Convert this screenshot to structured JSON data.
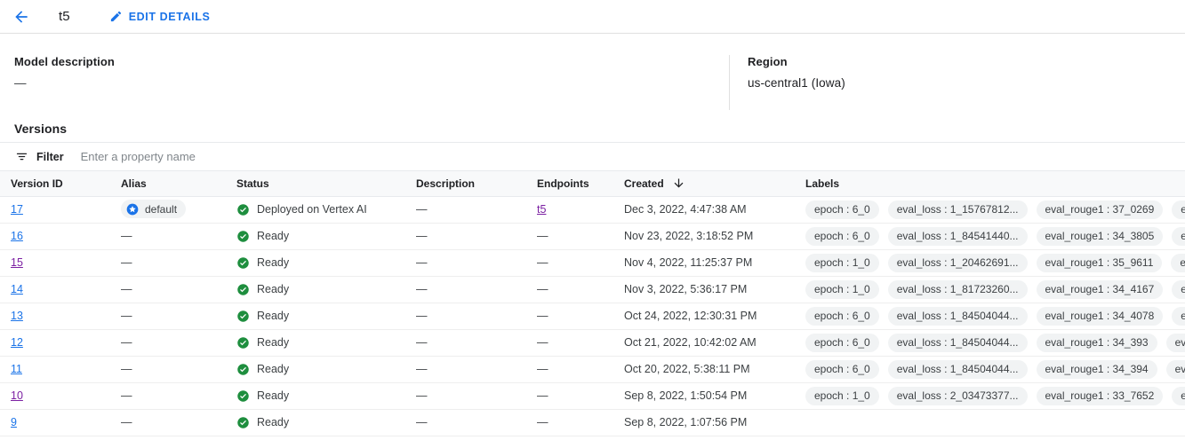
{
  "topbar": {
    "back_icon": "arrow-back-icon",
    "title": "t5",
    "edit_label": "EDIT DETAILS",
    "edit_icon": "pencil-icon",
    "accent": "#1a73e8"
  },
  "summary": {
    "description_label": "Model description",
    "description_value": "—",
    "region_label": "Region",
    "region_value": "us-central1 (Iowa)"
  },
  "versions_section": {
    "title": "Versions",
    "filter": {
      "icon": "filter-icon",
      "label": "Filter",
      "placeholder": "Enter a property name",
      "value": ""
    },
    "columns": [
      {
        "label": "Version ID",
        "muted": false
      },
      {
        "label": "Alias",
        "muted": false
      },
      {
        "label": "Status",
        "muted": false
      },
      {
        "label": "Description",
        "muted": false
      },
      {
        "label": "Endpoints",
        "muted": true
      },
      {
        "label": "Created",
        "muted": false
      },
      {
        "label": "Labels",
        "muted": true
      }
    ],
    "sort": {
      "column": "Created",
      "direction": "desc",
      "icon": "arrow-down-icon"
    },
    "rows": [
      {
        "version_id": "17",
        "visited": false,
        "alias": "default",
        "alias_is_chip": true,
        "alias_icon": "star-circle-icon",
        "status": "Deployed on Vertex AI",
        "status_icon": "check-circle-icon",
        "description": "—",
        "endpoint": "t5",
        "endpoint_is_link": true,
        "endpoint_visited": true,
        "created": "Dec 3, 2022, 4:47:38 AM",
        "labels": [
          "epoch : 6_0",
          "eval_loss : 1_15767812...",
          "eval_rouge1 : 37_0269",
          "eval"
        ]
      },
      {
        "version_id": "16",
        "visited": false,
        "alias": "—",
        "alias_is_chip": false,
        "status": "Ready",
        "status_icon": "check-circle-icon",
        "description": "—",
        "endpoint": "—",
        "endpoint_is_link": false,
        "created": "Nov 23, 2022, 3:18:52 PM",
        "labels": [
          "epoch : 6_0",
          "eval_loss : 1_84541440...",
          "eval_rouge1 : 34_3805",
          "eval"
        ]
      },
      {
        "version_id": "15",
        "visited": true,
        "alias": "—",
        "alias_is_chip": false,
        "status": "Ready",
        "status_icon": "check-circle-icon",
        "description": "—",
        "endpoint": "—",
        "endpoint_is_link": false,
        "created": "Nov 4, 2022, 11:25:37 PM",
        "labels": [
          "epoch : 1_0",
          "eval_loss : 1_20462691...",
          "eval_rouge1 : 35_9611",
          "eval"
        ]
      },
      {
        "version_id": "14",
        "visited": false,
        "alias": "—",
        "alias_is_chip": false,
        "status": "Ready",
        "status_icon": "check-circle-icon",
        "description": "—",
        "endpoint": "—",
        "endpoint_is_link": false,
        "created": "Nov 3, 2022, 5:36:17 PM",
        "labels": [
          "epoch : 1_0",
          "eval_loss : 1_81723260...",
          "eval_rouge1 : 34_4167",
          "eval"
        ]
      },
      {
        "version_id": "13",
        "visited": false,
        "alias": "—",
        "alias_is_chip": false,
        "status": "Ready",
        "status_icon": "check-circle-icon",
        "description": "—",
        "endpoint": "—",
        "endpoint_is_link": false,
        "created": "Oct 24, 2022, 12:30:31 PM",
        "labels": [
          "epoch : 6_0",
          "eval_loss : 1_84504044...",
          "eval_rouge1 : 34_4078",
          "eval"
        ]
      },
      {
        "version_id": "12",
        "visited": false,
        "alias": "—",
        "alias_is_chip": false,
        "status": "Ready",
        "status_icon": "check-circle-icon",
        "description": "—",
        "endpoint": "—",
        "endpoint_is_link": false,
        "created": "Oct 21, 2022, 10:42:02 AM",
        "labels": [
          "epoch : 6_0",
          "eval_loss : 1_84504044...",
          "eval_rouge1 : 34_393",
          "eval_"
        ]
      },
      {
        "version_id": "11",
        "visited": false,
        "alias": "—",
        "alias_is_chip": false,
        "status": "Ready",
        "status_icon": "check-circle-icon",
        "description": "—",
        "endpoint": "—",
        "endpoint_is_link": false,
        "created": "Oct 20, 2022, 5:38:11 PM",
        "labels": [
          "epoch : 6_0",
          "eval_loss : 1_84504044...",
          "eval_rouge1 : 34_394",
          "eval_"
        ]
      },
      {
        "version_id": "10",
        "visited": true,
        "alias": "—",
        "alias_is_chip": false,
        "status": "Ready",
        "status_icon": "check-circle-icon",
        "description": "—",
        "endpoint": "—",
        "endpoint_is_link": false,
        "created": "Sep 8, 2022, 1:50:54 PM",
        "labels": [
          "epoch : 1_0",
          "eval_loss : 2_03473377...",
          "eval_rouge1 : 33_7652",
          "eva"
        ]
      },
      {
        "version_id": "9",
        "visited": false,
        "alias": "—",
        "alias_is_chip": false,
        "status": "Ready",
        "status_icon": "check-circle-icon",
        "description": "—",
        "endpoint": "—",
        "endpoint_is_link": false,
        "created": "Sep 8, 2022, 1:07:56 PM",
        "labels": []
      }
    ]
  },
  "colors": {
    "link_blue": "#1a73e8",
    "link_visited": "#7b1fa2",
    "status_green": "#1e8e3e",
    "chip_bg": "#f1f3f4",
    "header_bg": "#f8f9fa"
  }
}
